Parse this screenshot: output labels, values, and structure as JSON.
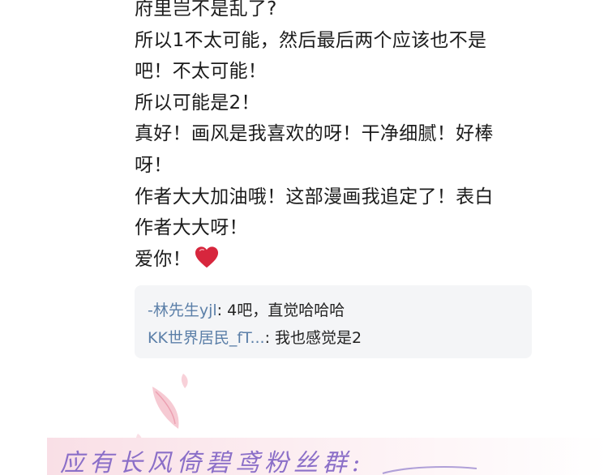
{
  "comment": {
    "lines": [
      "府里岂不是乱了?",
      "所以1不太可能，然后最后两个应该也不是",
      "吧！不太可能！",
      "所以可能是2！",
      "真好！画风是我喜欢的呀！干净细腻！好棒",
      "呀！",
      "作者大大加油哦！这部漫画我追定了！表白",
      "作者大大呀！",
      "爱你！"
    ],
    "heart_icon": "red-heart-emoji",
    "heart_color": "#d7263d"
  },
  "replies": [
    {
      "user": "-林先生yjl",
      "text": ": 4吧，直觉哈哈哈"
    },
    {
      "user": "KK世界居民_fT...",
      "text": ": 我也感觉是2"
    }
  ],
  "fan_banner": {
    "text": "应有长风倚碧鸢粉丝群:",
    "text_color": "#8b6fc8"
  },
  "colors": {
    "reply_user": "#5b7fa8",
    "reply_box_bg": "#f4f5f7"
  }
}
